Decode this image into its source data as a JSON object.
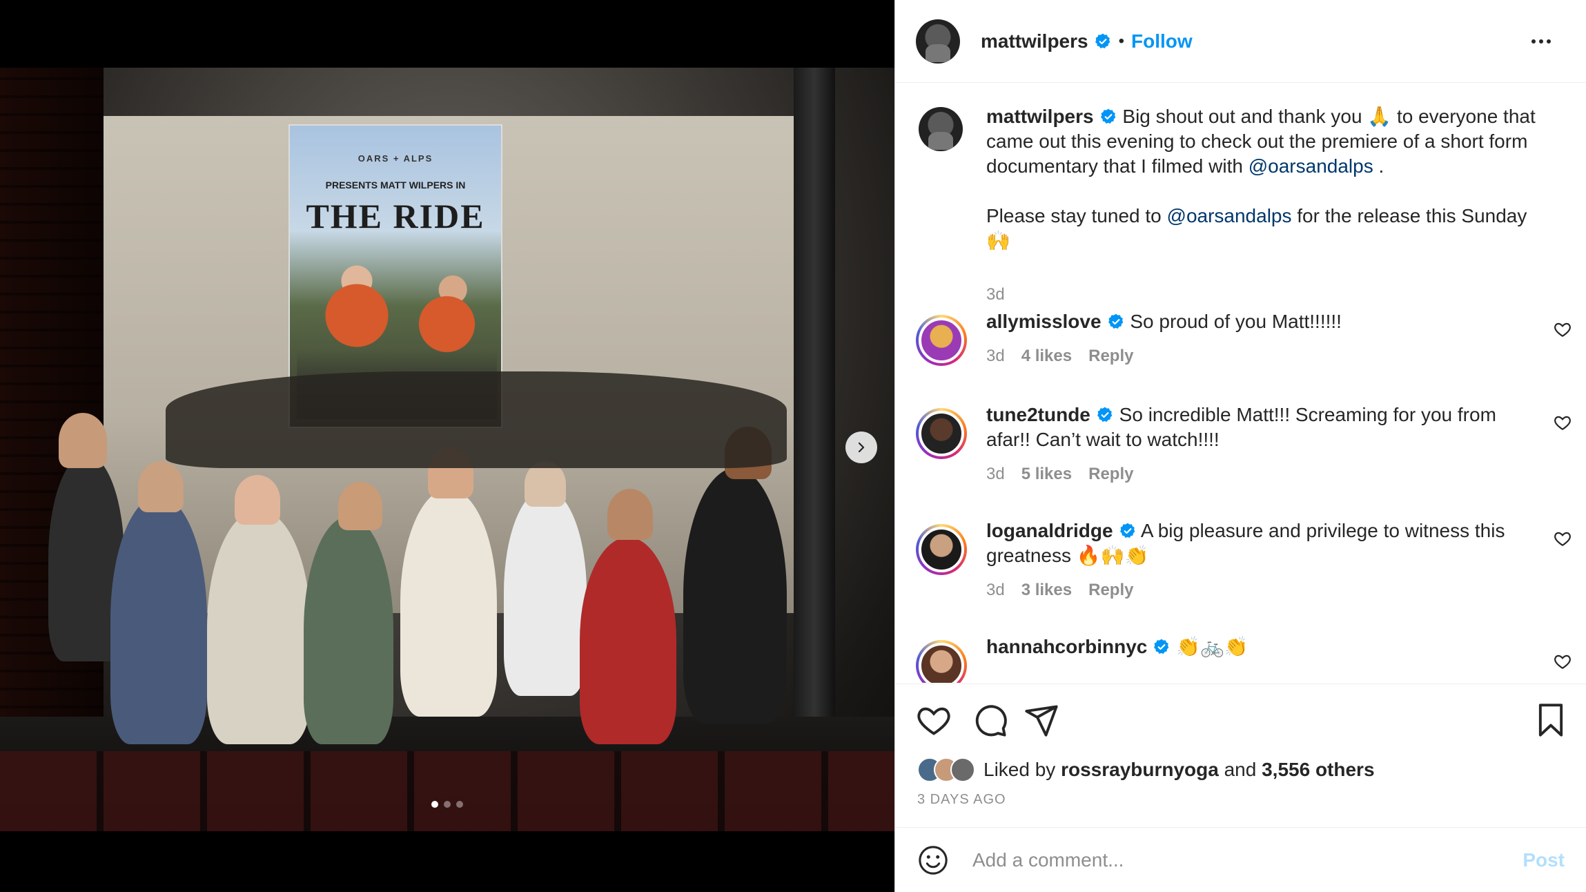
{
  "media": {
    "poster_brand": "OARS + ALPS",
    "poster_presents": "PRESENTS MATT WILPERS IN",
    "poster_title": "THE RIDE",
    "carousel_count": 3,
    "carousel_active": 0
  },
  "header": {
    "username": "mattwilpers",
    "separator": "•",
    "follow_label": "Follow"
  },
  "caption": {
    "username": "mattwilpers",
    "text_1": "Big shout out and thank you 🙏 to everyone that came out this evening to check out the premiere of a short form documentary that I filmed with ",
    "mention_1": "@oarsandalps",
    "text_2": " .",
    "text_3": "Please stay tuned to ",
    "mention_2": "@oarsandalps",
    "text_4": " for the release this Sunday 🙌",
    "time": "3d"
  },
  "comments": [
    {
      "username": "allymisslove",
      "text": "So proud of you Matt!!!!!!",
      "time": "3d",
      "likes": "4 likes",
      "reply": "Reply"
    },
    {
      "username": "tune2tunde",
      "text": "So incredible Matt!!! Screaming for you from afar!! Can’t wait to watch!!!!",
      "time": "3d",
      "likes": "5 likes",
      "reply": "Reply"
    },
    {
      "username": "loganaldridge",
      "text": "A big pleasure and privilege to witness this greatness 🔥🙌👏",
      "time": "3d",
      "likes": "3 likes",
      "reply": "Reply"
    },
    {
      "username": "hannahcorbinnyc",
      "text": "👏🚲👏",
      "time": "",
      "likes": "",
      "reply": ""
    }
  ],
  "likes": {
    "prefix": "Liked by ",
    "user": "rossrayburnyoga",
    "middle": " and ",
    "others": "3,556 others"
  },
  "date": "3 DAYS AGO",
  "add_comment": {
    "placeholder": "Add a comment...",
    "post_label": "Post"
  },
  "colors": {
    "accent": "#0095f6",
    "mention": "#00376b",
    "verified": "#0095f6",
    "muted": "#8e8e8e"
  }
}
